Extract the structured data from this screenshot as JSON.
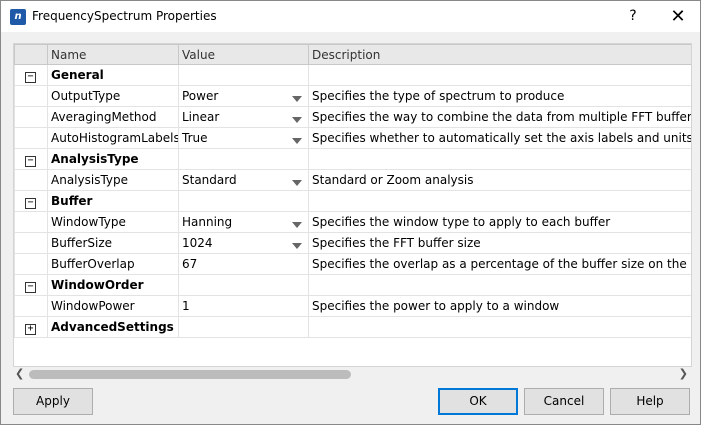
{
  "window": {
    "title": "FrequencySpectrum Properties",
    "app_icon_glyph": "n",
    "help_glyph": "?",
    "close_glyph": "✕"
  },
  "grid": {
    "columns": [
      "Name",
      "Value",
      "Description"
    ],
    "rows": [
      {
        "type": "category",
        "expander": "⊟",
        "name": "General"
      },
      {
        "type": "property",
        "name": "OutputType",
        "value": "Power",
        "dropdown": true,
        "description": "Specifies the type of spectrum to produce"
      },
      {
        "type": "property",
        "name": "AveragingMethod",
        "value": "Linear",
        "dropdown": true,
        "description": "Specifies the way to combine the data from multiple FFT buffers"
      },
      {
        "type": "property",
        "name": "AutoHistogramLabels",
        "value": "True",
        "dropdown": true,
        "description": "Specifies whether to automatically set the axis labels and units text o"
      },
      {
        "type": "category",
        "expander": "⊟",
        "name": "AnalysisType"
      },
      {
        "type": "property",
        "name": "AnalysisType",
        "value": "Standard",
        "dropdown": true,
        "description": "Standard or Zoom analysis"
      },
      {
        "type": "category",
        "expander": "⊟",
        "name": "Buffer"
      },
      {
        "type": "property",
        "name": "WindowType",
        "value": "Hanning",
        "dropdown": true,
        "description": "Specifies the window type to apply to each buffer"
      },
      {
        "type": "property",
        "name": "BufferSize",
        "value": "1024",
        "dropdown": true,
        "description": "Specifies the FFT buffer size"
      },
      {
        "type": "property",
        "name": "BufferOverlap",
        "value": "67",
        "dropdown": false,
        "description": "Specifies the overlap as a percentage of the buffer size on the input c"
      },
      {
        "type": "category",
        "expander": "⊟",
        "name": "WindowOrder"
      },
      {
        "type": "property",
        "name": "WindowPower",
        "value": "1",
        "dropdown": false,
        "description": "Specifies the power to apply to a window"
      },
      {
        "type": "category",
        "expander": "⊞",
        "name": "AdvancedSettings"
      }
    ]
  },
  "scrollbar": {
    "left_glyph": "❮",
    "right_glyph": "❯"
  },
  "buttons": {
    "apply": "Apply",
    "ok": "OK",
    "cancel": "Cancel",
    "help": "Help"
  }
}
